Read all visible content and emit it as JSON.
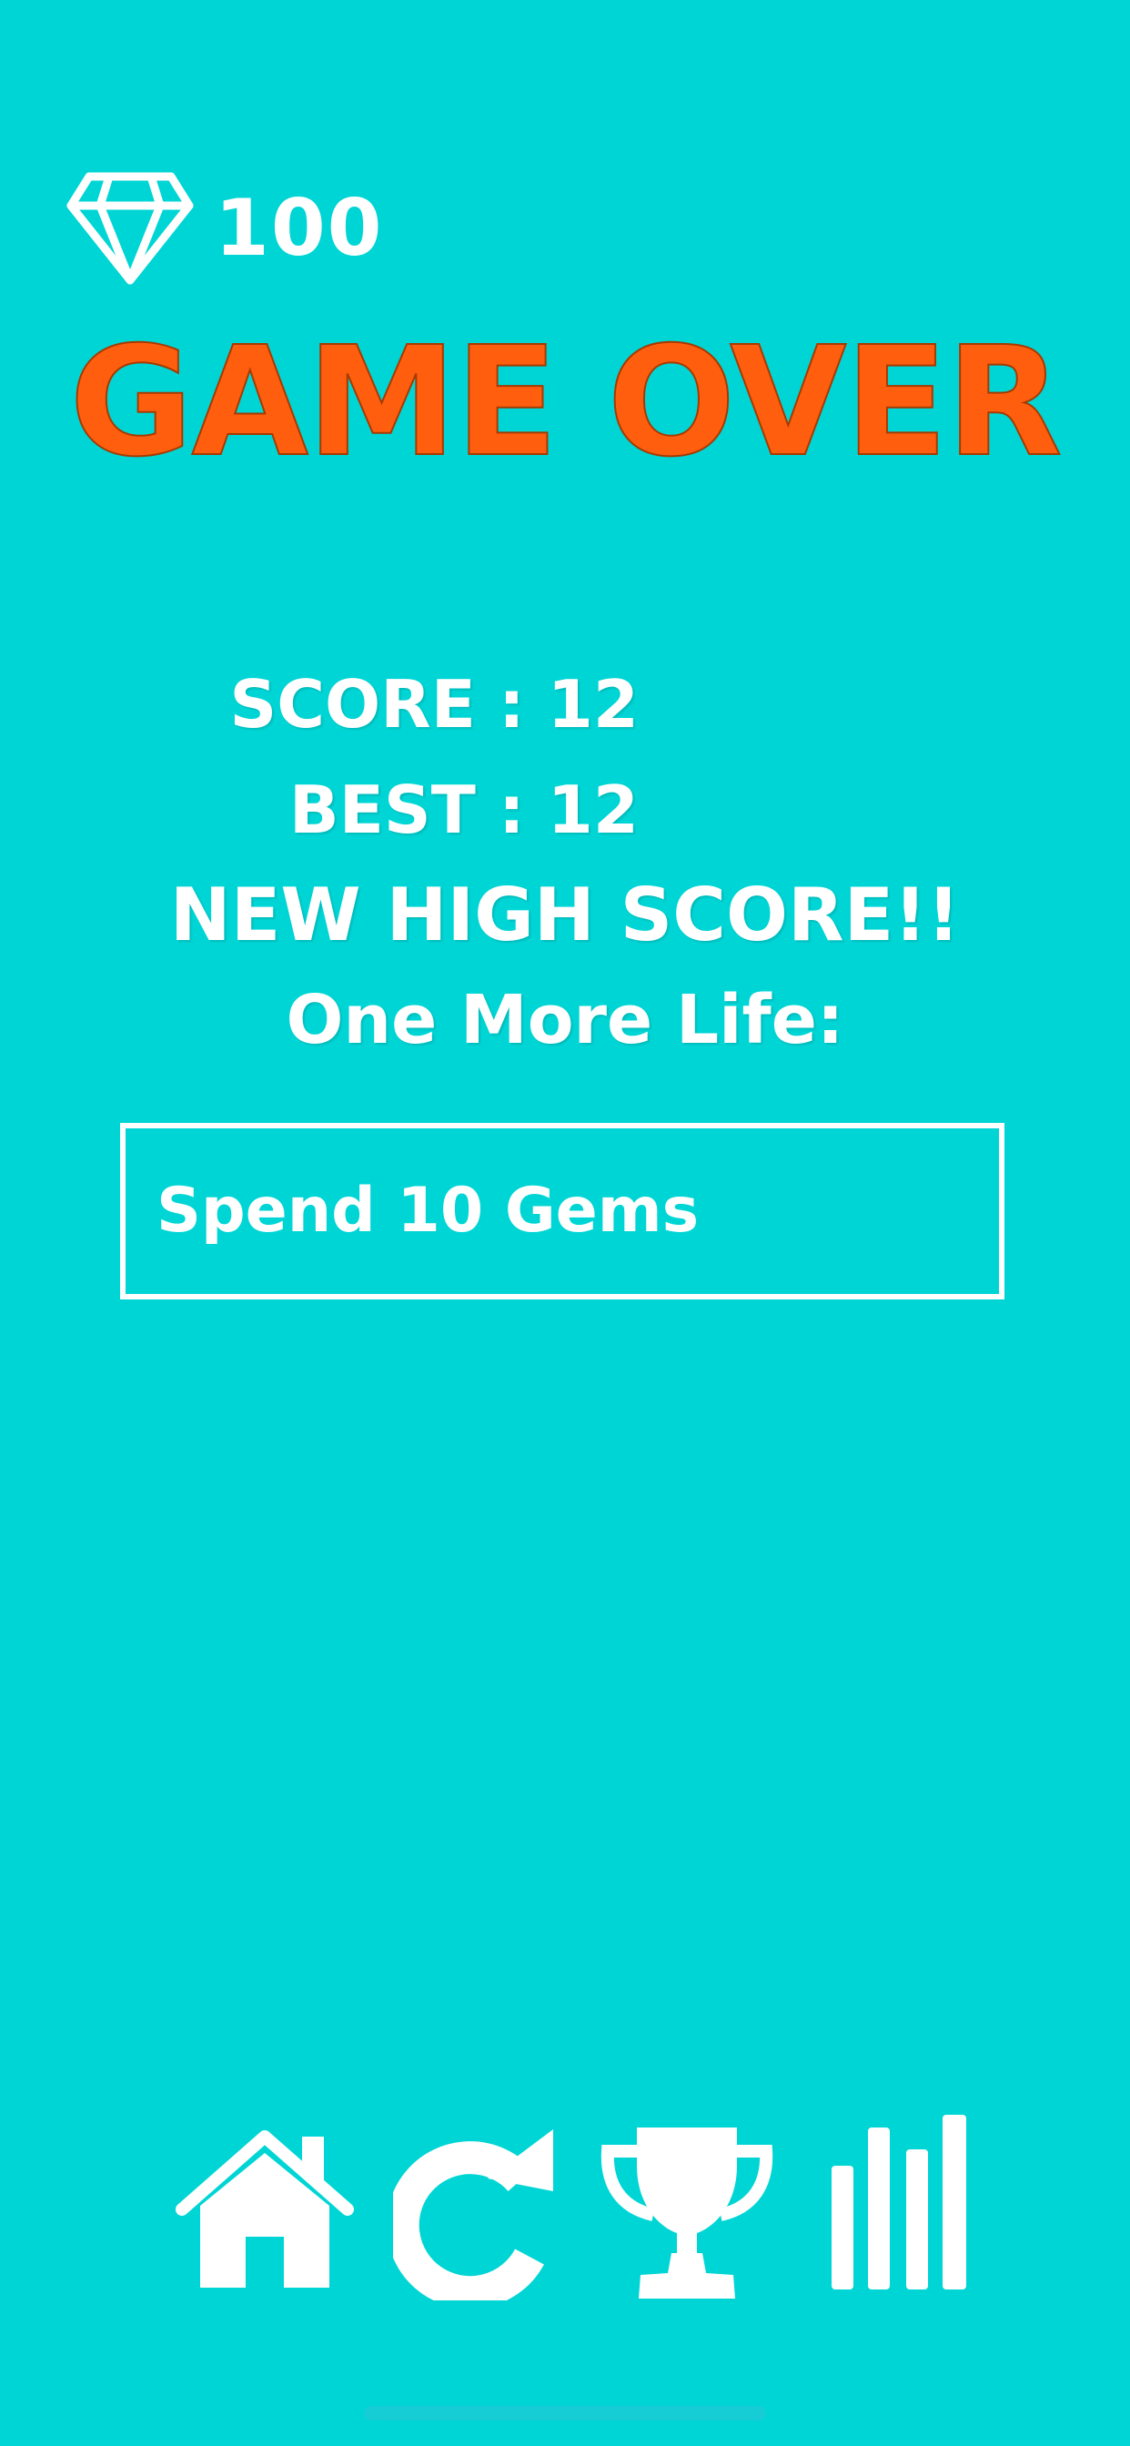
{
  "colors": {
    "background": "#00d5d5",
    "title": "#ff5e0e",
    "text": "#ffffff",
    "home_indicator": "#7aaee0"
  },
  "gems": {
    "icon": "diamond-icon",
    "count": "100"
  },
  "title": "GAME OVER",
  "score_label": "SCORE : 12",
  "best_label": "BEST : 12",
  "high_score_text": "NEW HIGH SCORE!!",
  "one_more_life_label": "One More Life:",
  "spend_button_label": "Spend 10 Gems",
  "bottom_bar": [
    {
      "name": "home",
      "icon": "home-icon"
    },
    {
      "name": "replay",
      "icon": "replay-icon"
    },
    {
      "name": "leaderboard",
      "icon": "trophy-icon"
    },
    {
      "name": "stats",
      "icon": "bar-chart-icon"
    }
  ]
}
